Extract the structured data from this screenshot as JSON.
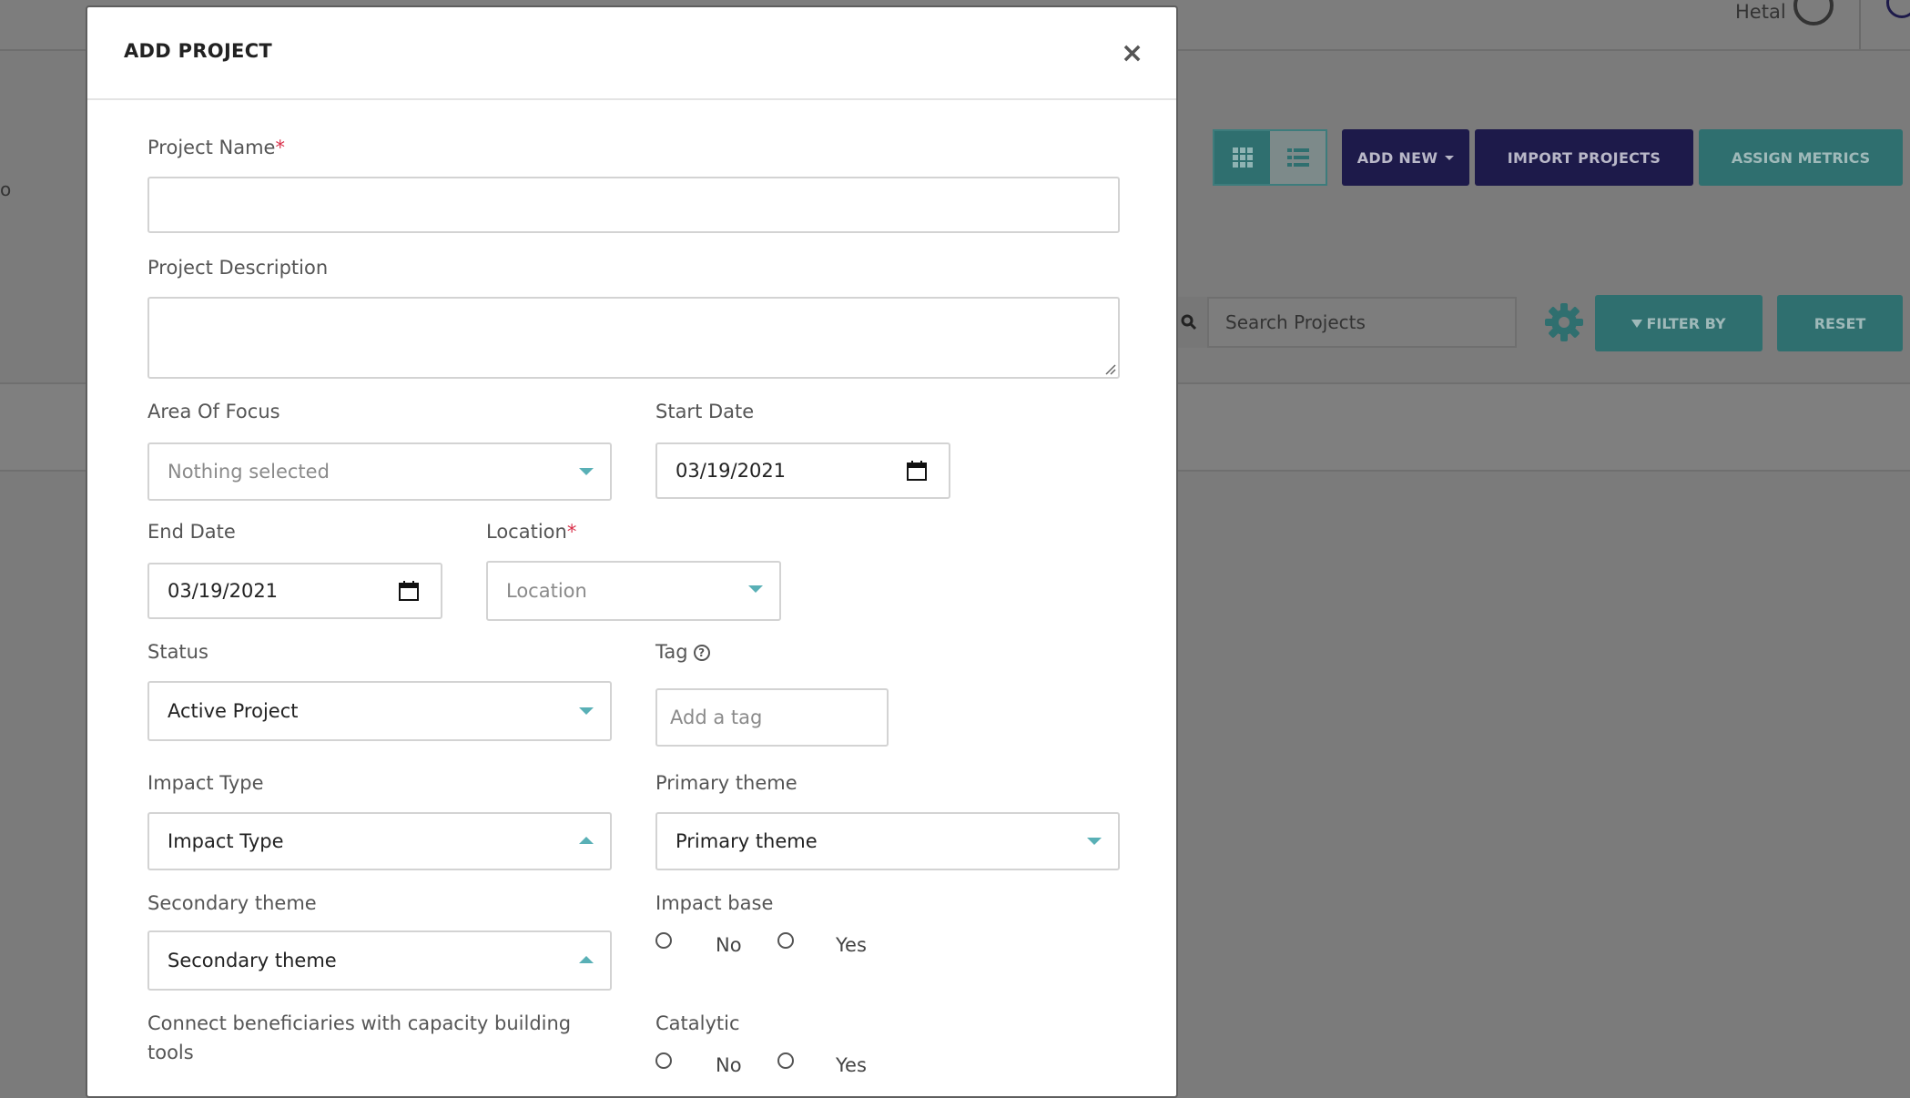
{
  "header": {
    "user_name": "Hetal"
  },
  "edge_text": "o",
  "toolbar": {
    "add_new": "ADD NEW",
    "import_projects": "IMPORT PROJECTS",
    "assign_metrics": "ASSIGN METRICS",
    "search_placeholder": "Search Projects",
    "filter_by": "FILTER BY",
    "reset": "RESET"
  },
  "modal": {
    "title": "ADD PROJECT",
    "close": "×",
    "project_name": {
      "label": "Project Name",
      "required": "*",
      "value": ""
    },
    "project_description": {
      "label": "Project Description",
      "value": ""
    },
    "area_of_focus": {
      "label": "Area Of Focus",
      "placeholder": "Nothing selected"
    },
    "start_date": {
      "label": "Start Date",
      "value": "03/19/2021"
    },
    "end_date": {
      "label": "End Date",
      "value": "03/19/2021"
    },
    "location": {
      "label": "Location",
      "required": "*",
      "placeholder": "Location"
    },
    "status": {
      "label": "Status",
      "value": "Active Project"
    },
    "tag": {
      "label": "Tag",
      "placeholder": "Add a tag"
    },
    "impact_type": {
      "label": "Impact Type",
      "value": "Impact Type"
    },
    "primary_theme": {
      "label": "Primary theme",
      "value": "Primary theme"
    },
    "secondary_theme": {
      "label": "Secondary theme",
      "value": "Secondary theme"
    },
    "impact_base": {
      "label": "Impact base",
      "options": [
        "No",
        "Yes"
      ]
    },
    "connect_beneficiaries": {
      "label_line1": "Connect beneficiaries with capacity building",
      "label_line2": "tools"
    },
    "catalytic": {
      "label": "Catalytic",
      "options": [
        "No",
        "Yes"
      ]
    }
  },
  "colors": {
    "primary_dark": "#2a2565",
    "teal": "#4fa5a5",
    "required": "#d9304a",
    "caret": "#59b0b6"
  }
}
